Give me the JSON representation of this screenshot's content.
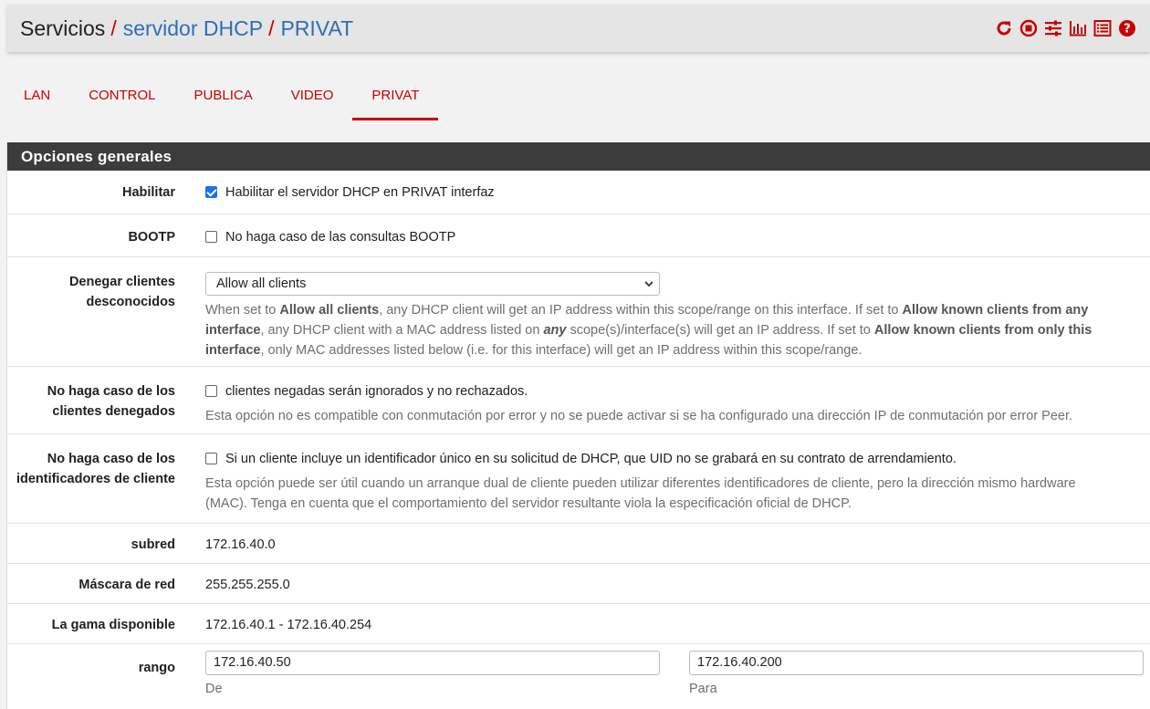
{
  "breadcrumb": {
    "root": "Servicios",
    "sep1": "/",
    "level2": "servidor DHCP",
    "sep2": "/",
    "level3": "PRIVAT"
  },
  "toolbar_icons": [
    "restart-icon",
    "stop-icon",
    "settings-icon",
    "chart-icon",
    "list-icon",
    "help-icon"
  ],
  "tabs": [
    {
      "label": "LAN",
      "active": false
    },
    {
      "label": "CONTROL",
      "active": false
    },
    {
      "label": "PUBLICA",
      "active": false
    },
    {
      "label": "VIDEO",
      "active": false
    },
    {
      "label": "PRIVAT",
      "active": true
    }
  ],
  "panel": {
    "title": "Opciones generales",
    "enable": {
      "label": "Habilitar",
      "checked": true,
      "text": "Habilitar el servidor DHCP en PRIVAT interfaz"
    },
    "bootp": {
      "label": "BOOTP",
      "checked": false,
      "text": "No haga caso de las consultas BOOTP"
    },
    "deny": {
      "label_line1": "Denegar clientes",
      "label_line2": "desconocidos",
      "selected": "Allow all clients",
      "help": {
        "p1": "When set to ",
        "b1": "Allow all clients",
        "p2": ", any DHCP client will get an IP address within this scope/range on this interface. If set to ",
        "b2": "Allow known clients from any interface",
        "p3": ", any DHCP client with a MAC address listed on ",
        "i1": "any",
        "p4": " scope(s)/interface(s) will get an IP address. If set to ",
        "b3": "Allow known clients from only this interface",
        "p5": ", only MAC addresses listed below (i.e. for this interface) will get an IP address within this scope/range."
      }
    },
    "ignore_denied": {
      "label_line1": "No haga caso de los",
      "label_line2": "clientes denegados",
      "checked": false,
      "text": "clientes negadas serán ignorados y no rechazados.",
      "help": "Esta opción no es compatible con conmutación por error y no se puede activar si se ha configurado una dirección IP de conmutación por error Peer."
    },
    "ignore_uid": {
      "label_line1": "No haga caso de los",
      "label_line2": "identificadores de cliente",
      "checked": false,
      "text": "Si un cliente incluye un identificador único en su solicitud de DHCP, que UID no se grabará en su contrato de arrendamiento.",
      "help_line1": "Esta opción puede ser útil cuando un arranque dual de cliente pueden utilizar diferentes identificadores de cliente, pero la dirección mismo hardware",
      "help_line2": "(MAC). Tenga en cuenta que el comportamiento del servidor resultante viola la especificación oficial de DHCP."
    },
    "subnet": {
      "label": "subred",
      "value": "172.16.40.0"
    },
    "mask": {
      "label": "Máscara de red",
      "value": "255.255.255.0"
    },
    "available": {
      "label": "La gama disponible",
      "value": "172.16.40.1 - 172.16.40.254"
    },
    "range": {
      "label": "rango",
      "from_value": "172.16.40.50",
      "from_hint": "De",
      "to_value": "172.16.40.200",
      "to_hint": "Para"
    }
  },
  "colors": {
    "accent": "#c80000",
    "link": "#2e6eb5",
    "panel_header": "#3c3c3c",
    "checkbox": "#1a73e8"
  }
}
